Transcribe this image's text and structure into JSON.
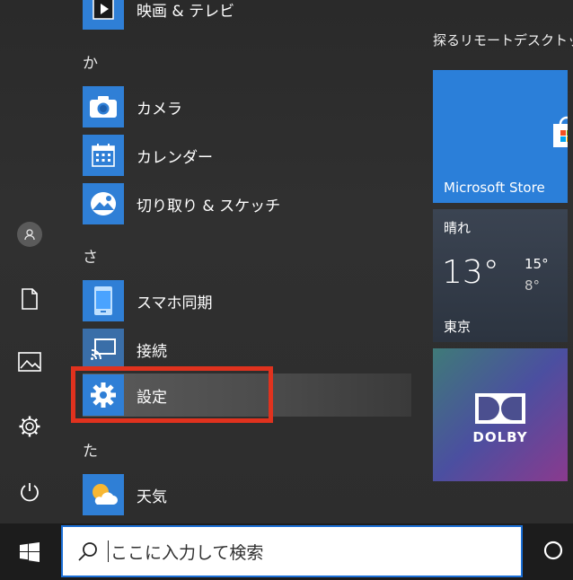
{
  "start_menu": {
    "sections": [
      {
        "letter": "",
        "apps": [
          {
            "label": "映画 & テレビ",
            "icon": "film-tv-icon"
          }
        ]
      },
      {
        "letter": "か",
        "apps": [
          {
            "label": "カメラ",
            "icon": "camera-icon"
          },
          {
            "label": "カレンダー",
            "icon": "calendar-icon"
          },
          {
            "label": "切り取り & スケッチ",
            "icon": "snip-sketch-icon"
          }
        ]
      },
      {
        "letter": "さ",
        "apps": [
          {
            "label": "スマホ同期",
            "icon": "phone-link-icon"
          },
          {
            "label": "接続",
            "icon": "connect-icon"
          },
          {
            "label": "設定",
            "icon": "gear-icon"
          }
        ]
      },
      {
        "letter": "た",
        "apps": [
          {
            "label": "天気",
            "icon": "weather-icon"
          }
        ]
      }
    ],
    "rail": [
      "user-icon",
      "document-icon",
      "pictures-icon",
      "settings-gear-icon",
      "power-icon"
    ]
  },
  "tiles": {
    "header": "探るリモートデスクトップ",
    "store": {
      "label": "Microsoft Store"
    },
    "weather": {
      "condition": "晴れ",
      "temp": "13°",
      "high": "15°",
      "low": "8°",
      "city": "東京"
    },
    "dolby": {
      "label": "DOLBY"
    }
  },
  "taskbar": {
    "search_placeholder": "ここに入力して検索"
  },
  "colors": {
    "accent": "#2f7fd6",
    "highlight": "#e0321e"
  }
}
